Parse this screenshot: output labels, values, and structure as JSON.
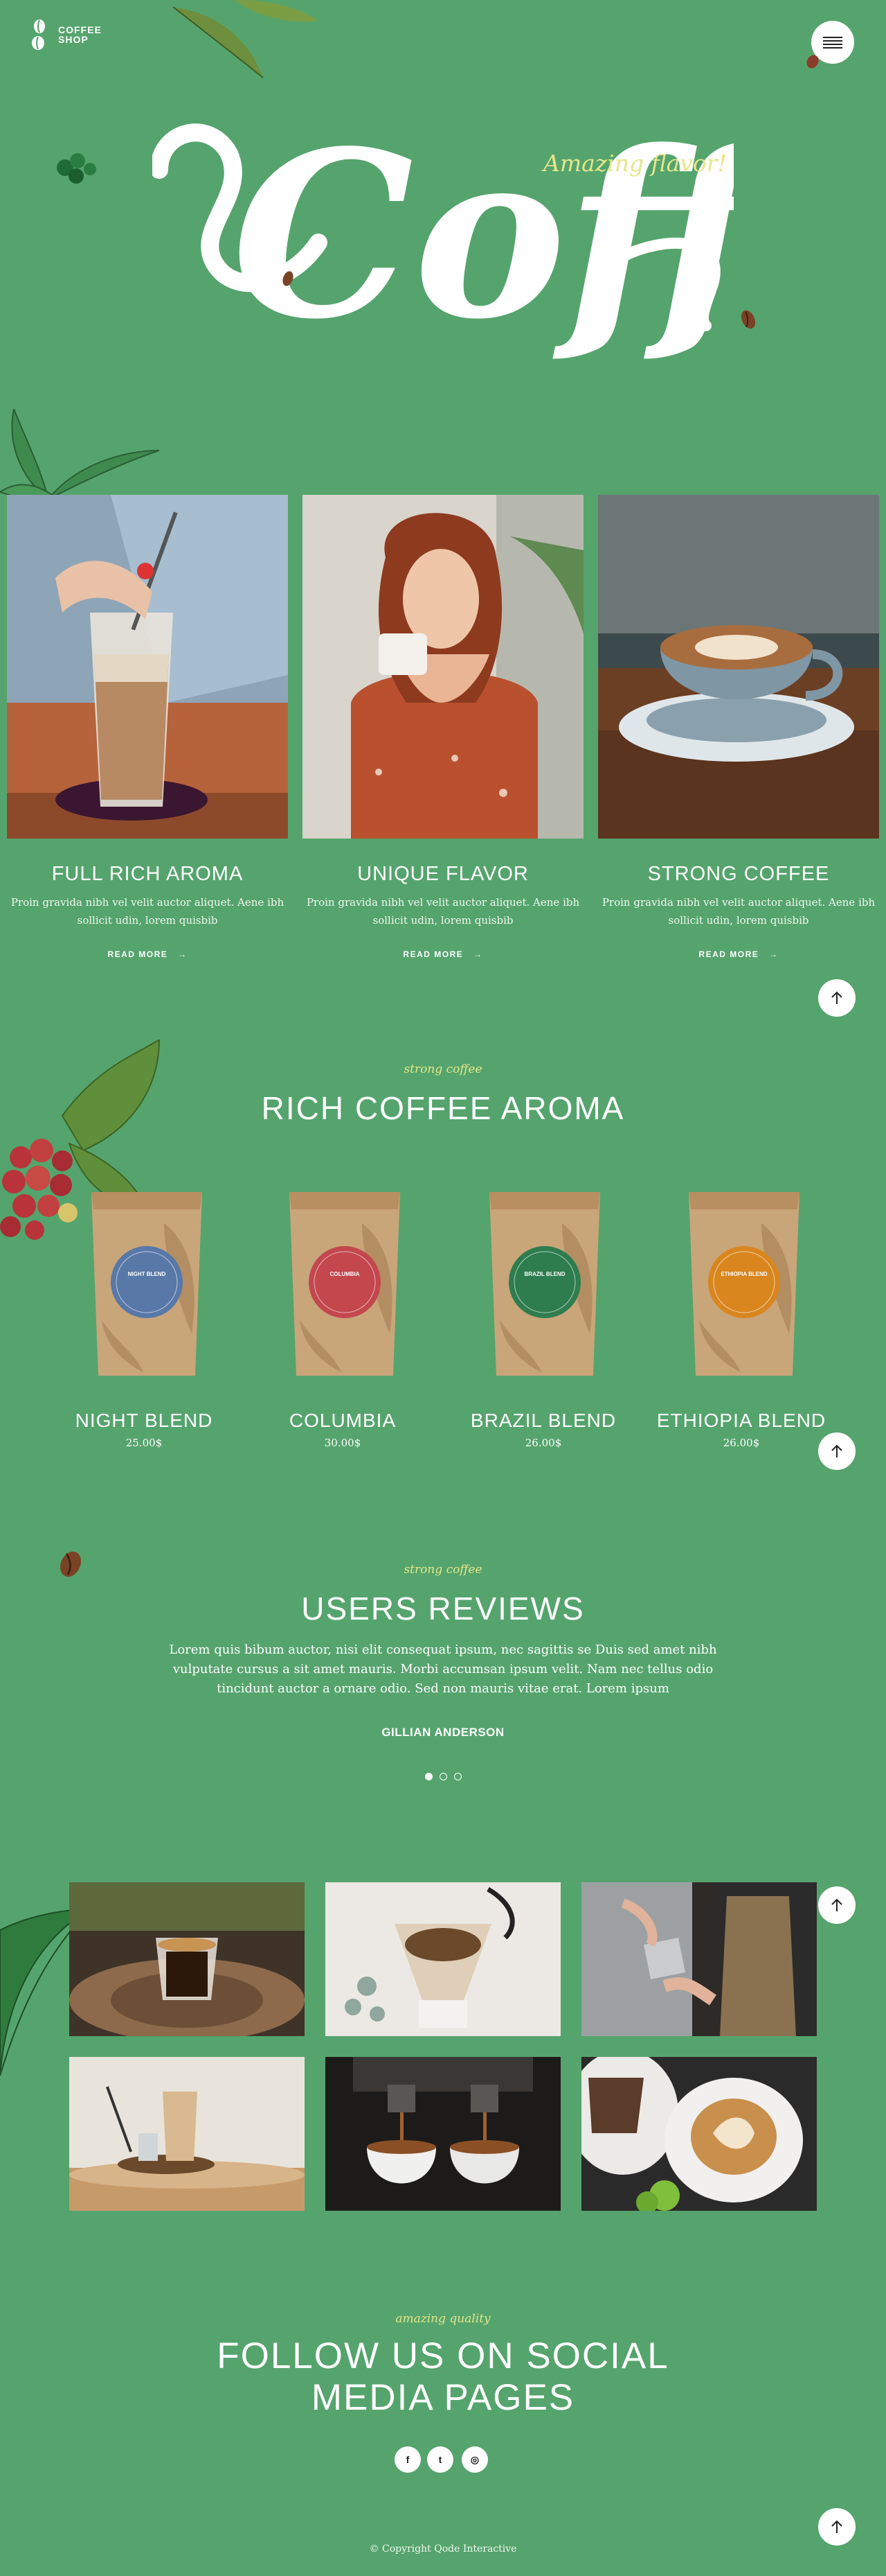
{
  "header": {
    "logo_line1": "COFFEE",
    "logo_line2": "SHOP",
    "menu_icon": "hamburger-icon"
  },
  "hero": {
    "script_word": "Coffee",
    "tagline": "Amazing flavor!"
  },
  "features": [
    {
      "title": "FULL RICH AROMA",
      "text": "Proin gravida nibh vel velit auctor aliquet. Aene ibh sollicit udin, lorem quisbib",
      "link": "READ MORE"
    },
    {
      "title": "UNIQUE FLAVOR",
      "text": "Proin gravida nibh vel velit auctor aliquet. Aene ibh sollicit udin, lorem quisbib",
      "link": "READ MORE"
    },
    {
      "title": "STRONG COFFEE",
      "text": "Proin gravida nibh vel velit auctor aliquet. Aene ibh sollicit udin, lorem quisbib",
      "link": "READ MORE"
    }
  ],
  "products_section": {
    "kicker": "strong coffee",
    "title": "RICH COFFEE AROMA",
    "items": [
      {
        "name": "NIGHT BLEND",
        "price": "25.00$",
        "label_color": "#5878a8",
        "label_text": "NIGHT BLEND"
      },
      {
        "name": "COLUMBIA",
        "price": "30.00$",
        "label_color": "#c4474e",
        "label_text": "COLUMBIA"
      },
      {
        "name": "BRAZIL BLEND",
        "price": "26.00$",
        "label_color": "#2e7d4f",
        "label_text": "BRAZIL BLEND"
      },
      {
        "name": "ETHIOPIA BLEND",
        "price": "26.00$",
        "label_color": "#d9861f",
        "label_text": "ETHIOPIA BLEND"
      }
    ]
  },
  "reviews": {
    "kicker": "strong coffee",
    "title": "USERS REVIEWS",
    "text": "Lorem quis bibum auctor, nisi elit consequat ipsum, nec sagittis se Duis sed amet nibh vulputate cursus a sit amet mauris. Morbi accumsan ipsum velit. Nam nec tellus odio tincidunt auctor a ornare odio. Sed non mauris vitae erat. Lorem ipsum",
    "author": "GILLIAN ANDERSON",
    "slides": 3,
    "active_slide": 0
  },
  "social_section": {
    "kicker": "amazing quality",
    "title_line1": "FOLLOW US ON SOCIAL",
    "title_line2": "MEDIA PAGES",
    "links": [
      {
        "icon": "facebook-icon",
        "glyph": "f"
      },
      {
        "icon": "twitter-icon",
        "glyph": "t"
      },
      {
        "icon": "instagram-icon",
        "glyph": "◎"
      }
    ]
  },
  "footer": {
    "copyright": "© Copyright Qode Interactive"
  },
  "colors": {
    "background": "#55a46d",
    "accent_yellow": "#e6e68a",
    "text": "#ffffff"
  }
}
